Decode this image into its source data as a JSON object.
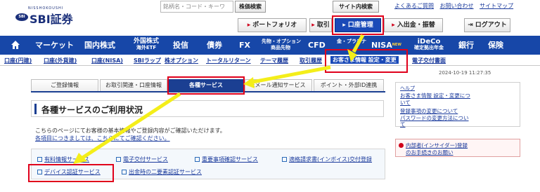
{
  "header": {
    "logo_kana": "NISSHOKOUSHI",
    "logo_badge": "SBI",
    "logo_name": "SBI証券",
    "search_placeholder": "銘柄名・コード・キーワ",
    "search_button": "株価検索",
    "site_search_button": "サイト内検索",
    "top_links": [
      "よくあるご質問",
      "お問い合わせ",
      "サイトマップ"
    ],
    "buttons": {
      "portfolio": "ポートフォリオ",
      "trade": "取引",
      "account": "口座管理",
      "deposit": "入出金・振替",
      "logout": "ログアウト"
    }
  },
  "global_nav": {
    "items": [
      "マーケット",
      "国内株式",
      "外国株式",
      "投信",
      "債券",
      "FX",
      "先物・オプション",
      "CFD",
      "金・プラチナ",
      "NISA",
      "iDeCo",
      "銀行",
      "保険"
    ],
    "sub_labels": {
      "foreign": "海外ETF",
      "futures": "商品先物",
      "ideco": "確定拠出年金"
    },
    "nisa_badge": "NEW"
  },
  "sub_nav": {
    "items": [
      "口座(円建)",
      "口座(外貨建)",
      "口座(NISA)",
      "SBIラップ",
      "株オプション",
      "トータルリターン",
      "テーマ履歴",
      "取引履歴"
    ],
    "selected": "お客さま情報 設定・変更",
    "after": "電子交付書面"
  },
  "timestamp": "2024-10-19 11:27:35",
  "tabs": [
    "ご登録情報",
    "お取引関連・口座情報",
    "各種サービス",
    "Eメール通知サービス",
    "ポイント・外部ID連携"
  ],
  "page_title": "各種サービスのご利用状況",
  "body_text": "こちらのページにてお客様の基本情報やご登録内容がご確認いただけます。",
  "body_link": "各項目につきましては、こちらにてご確認ください。",
  "services": [
    "有料情報サービス",
    "電子交付サービス",
    "重要事項確認サービス",
    "適格請求書(インボイス)交付登録",
    "デバイス認証サービス",
    "出金時の二要素認証サービス"
  ],
  "help": {
    "title": "ヘルプ",
    "lines": [
      "お客さま情報 設定・変更につ",
      "いて",
      "登録事項の変更について",
      "パスワードの変更方法につい",
      "て"
    ]
  },
  "insider": {
    "lines": [
      "内部者(インサイダー)登録",
      "のお手続きのお願い"
    ]
  },
  "colors": {
    "nav_blue": "#1747a8",
    "tab_active": "#1b3f92",
    "annotation_red": "#e0001b",
    "annotation_arrow": "#f4ee1a"
  }
}
